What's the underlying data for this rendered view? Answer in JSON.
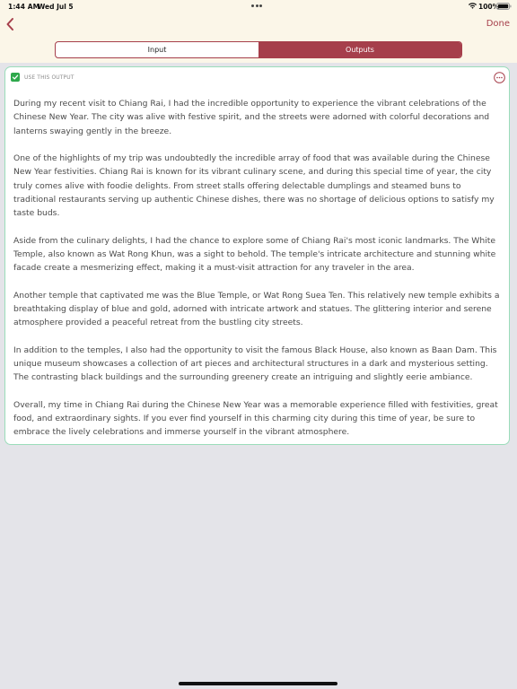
{
  "status_bar": {
    "time": "1:44 AM",
    "date": "Wed Jul 5",
    "battery": "100%"
  },
  "nav": {
    "back_icon": "chevron-left-icon",
    "done_label": "Done",
    "accent_color": "#a63f4b"
  },
  "segments": {
    "input_label": "Input",
    "outputs_label": "Outputs",
    "selected": "Outputs"
  },
  "output": {
    "use_this_output_label": "USE THIS OUTPUT",
    "checked": true,
    "checkbox_color": "#2ea84c",
    "more_icon": "ellipsis-circle-icon",
    "paragraphs": [
      "During my recent visit to Chiang Rai, I had the incredible opportunity to experience the vibrant celebrations of the Chinese New Year. The city was alive with festive spirit, and the streets were adorned with colorful decorations and lanterns swaying gently in the breeze.",
      "One of the highlights of my trip was undoubtedly the incredible array of food that was available during the Chinese New Year festivities. Chiang Rai is known for its vibrant culinary scene, and during this special time of year, the city truly comes alive with foodie delights. From street stalls offering delectable dumplings and steamed buns to traditional restaurants serving up authentic Chinese dishes, there was no shortage of delicious options to satisfy my taste buds.",
      "Aside from the culinary delights, I had the chance to explore some of Chiang Rai's most iconic landmarks. The White Temple, also known as Wat Rong Khun, was a sight to behold. The temple's intricate architecture and stunning white facade create a mesmerizing effect, making it a must-visit attraction for any traveler in the area.",
      "Another temple that captivated me was the Blue Temple, or Wat Rong Suea Ten. This relatively new temple exhibits a breathtaking display of blue and gold, adorned with intricate artwork and statues. The glittering interior and serene atmosphere provided a peaceful retreat from the bustling city streets.",
      "In addition to the temples, I also had the opportunity to visit the famous Black House, also known as Baan Dam. This unique museum showcases a collection of art pieces and architectural structures in a dark and mysterious setting. The contrasting black buildings and the surrounding greenery create an intriguing and slightly eerie ambiance.",
      "Overall, my time in Chiang Rai during the Chinese New Year was a memorable experience filled with festivities, great food, and extraordinary sights. If you ever find yourself in this charming city during this time of year, be sure to embrace the lively celebrations and immerse yourself in the vibrant atmosphere."
    ]
  }
}
